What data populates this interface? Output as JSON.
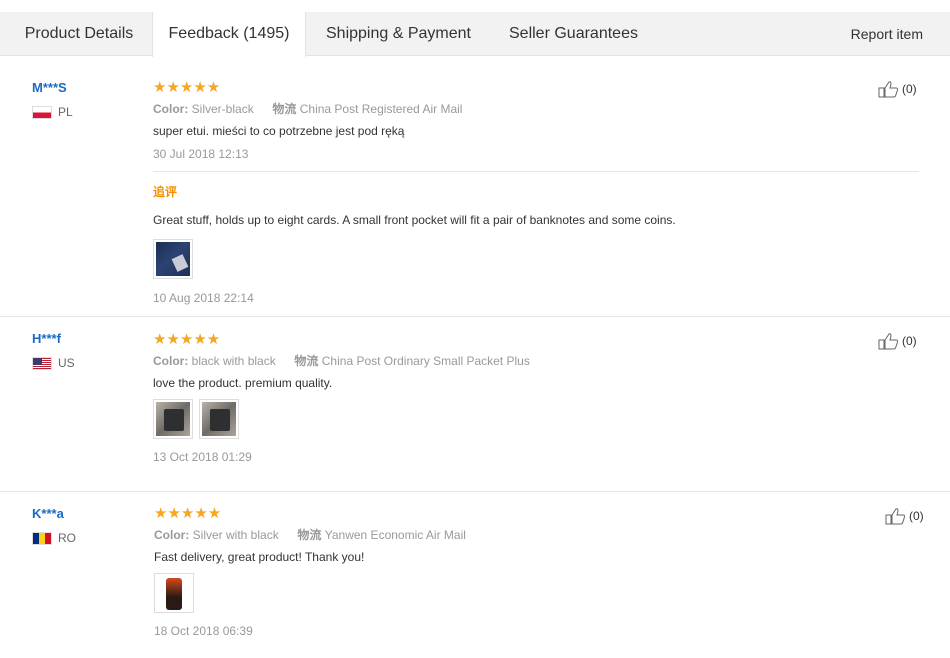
{
  "tabs": [
    {
      "label": "Product Details"
    },
    {
      "label": "Feedback (1495)"
    },
    {
      "label": "Shipping & Payment"
    },
    {
      "label": "Seller Guarantees"
    }
  ],
  "report_label": "Report item",
  "feedback": [
    {
      "user": "M***S",
      "country": "PL",
      "stars": "★★★★★",
      "color_label": "Color:",
      "color_value": "Silver-black",
      "ship_label": "物流",
      "ship_value": "China Post Registered Air Mail",
      "text": "super etui. mieści to co potrzebne jest pod ręką",
      "date": "30 Jul 2018 12:13",
      "additional_label": "追评",
      "additional_text": "Great stuff, holds up to eight cards. A small front pocket will fit a pair of banknotes and some coins.",
      "additional_date": "10 Aug 2018 22:14",
      "likes": "(0)"
    },
    {
      "user": "H***f",
      "country": "US",
      "stars": "★★★★★",
      "color_label": "Color:",
      "color_value": "black with black",
      "ship_label": "物流",
      "ship_value": "China Post Ordinary Small Packet Plus",
      "text": "love the product. premium quality.",
      "date": "13 Oct 2018 01:29",
      "likes": "(0)"
    },
    {
      "user": "K***a",
      "country": "RO",
      "stars": "★★★★★",
      "color_label": "Color:",
      "color_value": "Silver with black",
      "ship_label": "物流",
      "ship_value": "Yanwen Economic Air Mail",
      "text": "Fast delivery, great product! Thank you!",
      "date": "18 Oct 2018 06:39",
      "likes": "(0)"
    }
  ],
  "colors": {
    "accent_star": "#f5a623",
    "username": "#1a6bc4",
    "additional_label": "#f29000"
  }
}
